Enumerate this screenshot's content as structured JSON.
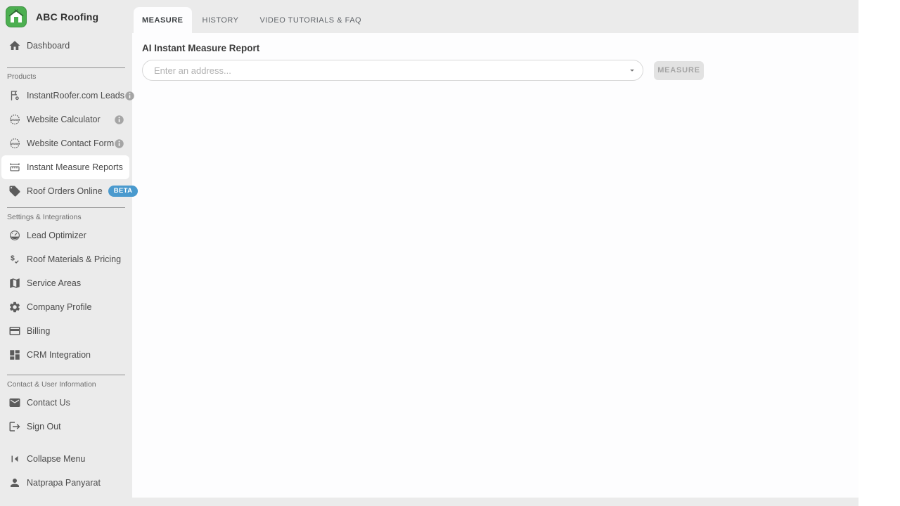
{
  "brand": {
    "name": "ABC Roofing"
  },
  "sidebar": {
    "dashboard": {
      "label": "Dashboard"
    },
    "sections": [
      {
        "label": "Products",
        "items": [
          {
            "label": "InstantRoofer.com Leads",
            "icon": "flag-gear-icon",
            "has_info": true
          },
          {
            "label": "Website Calculator",
            "icon": "globe-www-icon",
            "has_info": true
          },
          {
            "label": "Website Contact Form",
            "icon": "globe-www-icon",
            "has_info": true
          },
          {
            "label": "Instant Measure Reports",
            "icon": "ruler-icon",
            "selected": true
          },
          {
            "label": "Roof Orders Online",
            "icon": "tag-icon",
            "badge": "BETA"
          }
        ]
      },
      {
        "label": "Settings & Integrations",
        "items": [
          {
            "label": "Lead Optimizer",
            "icon": "gauge-icon"
          },
          {
            "label": "Roof Materials & Pricing",
            "icon": "dollar-check-icon"
          },
          {
            "label": "Service Areas",
            "icon": "map-icon"
          },
          {
            "label": "Company Profile",
            "icon": "gear-icon"
          },
          {
            "label": "Billing",
            "icon": "credit-card-icon"
          },
          {
            "label": "CRM Integration",
            "icon": "grid-icon"
          }
        ]
      },
      {
        "label": "Contact & User Information",
        "items": [
          {
            "label": "Contact Us",
            "icon": "mail-icon"
          },
          {
            "label": "Sign Out",
            "icon": "sign-out-icon"
          }
        ]
      }
    ],
    "footer": {
      "collapse": {
        "label": "Collapse Menu",
        "icon": "collapse-left-icon"
      },
      "user": {
        "label": "Natprapa Panyarat",
        "icon": "person-icon"
      }
    }
  },
  "tabs": [
    {
      "label": "MEASURE",
      "selected": true
    },
    {
      "label": "HISTORY",
      "selected": false
    },
    {
      "label": "VIDEO TUTORIALS & FAQ",
      "selected": false
    }
  ],
  "main": {
    "title": "AI Instant Measure Report",
    "address_input": {
      "value": "",
      "placeholder": "Enter an address..."
    },
    "measure_button": {
      "label": "MEASURE",
      "disabled": true
    }
  },
  "colors": {
    "brand_green": "#4caf50",
    "beta_blue": "#4a9ace",
    "sidebar_bg": "#ebebeb",
    "tab_strip_bg": "#ebebeb",
    "selected_item_bg": "#ffffff",
    "content_bg": "#fdfdfe",
    "divider": "#8f8f8f",
    "info_icon": "#a5a5a5",
    "disabled_button_bg": "#e2e2e2",
    "disabled_button_text": "#a4a4a4"
  }
}
